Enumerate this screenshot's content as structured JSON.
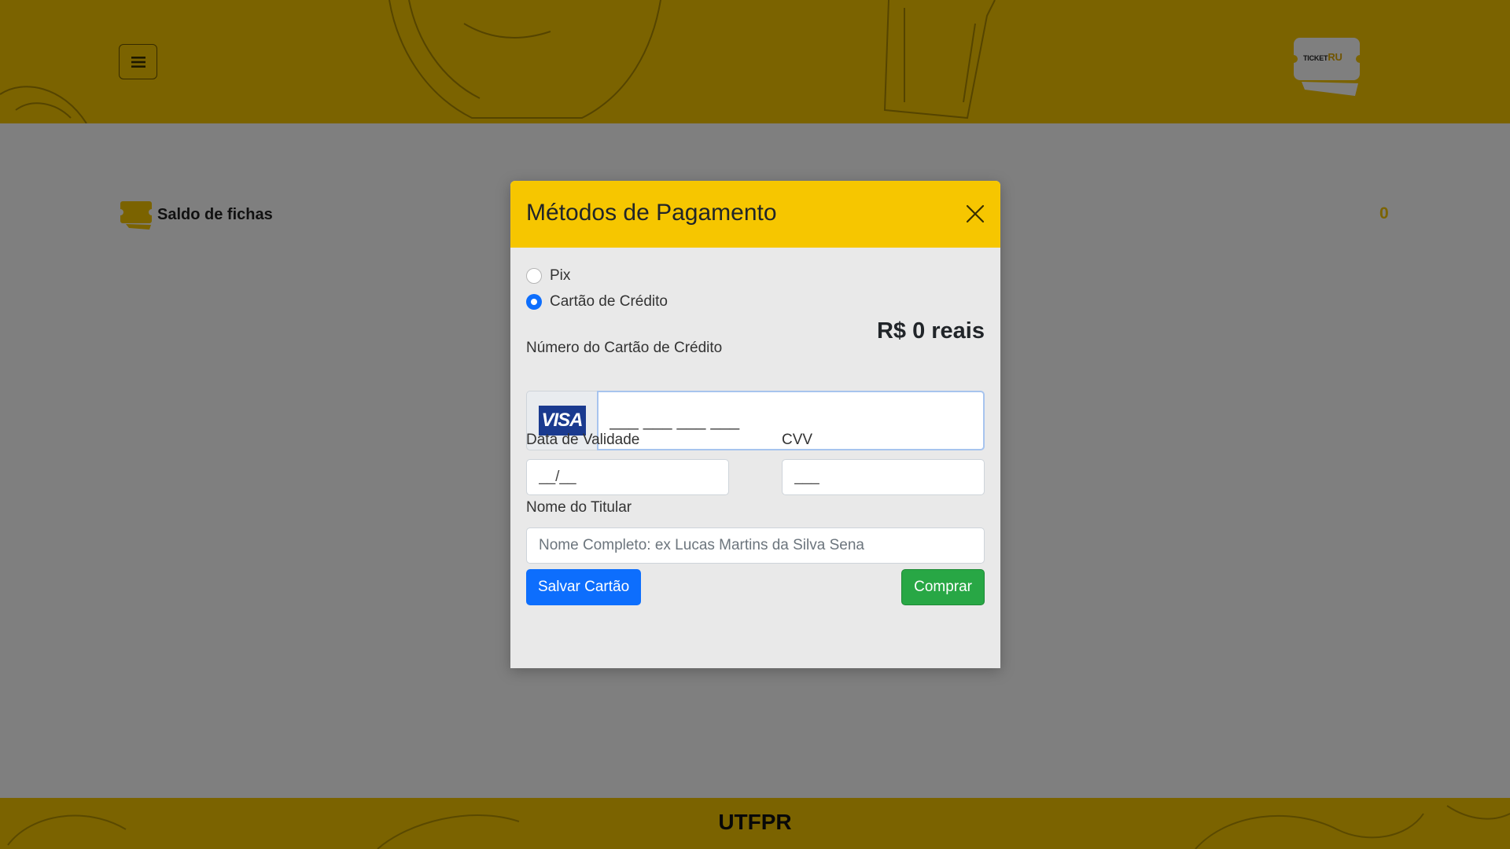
{
  "header": {
    "menu_icon": "hamburger-icon",
    "logo": {
      "text_ticket": "TICKET",
      "text_ru": "RU"
    }
  },
  "balance": {
    "icon": "ticket-icon",
    "label": "Saldo de fichas",
    "count": "0"
  },
  "footer": {
    "label": "UTFPR"
  },
  "modal": {
    "title": "Métodos de Pagamento",
    "close_icon": "close-icon",
    "payment_options": [
      {
        "label": "Pix",
        "checked": false
      },
      {
        "label": "Cartão de Crédito",
        "checked": true
      }
    ],
    "amount": "R$ 0 reais",
    "card_number": {
      "label": "Número do Cartão de Crédito",
      "brand": "VISA",
      "value": "___ ___ ___ ___"
    },
    "expiry": {
      "label": "Data de Validade",
      "value": "__/__"
    },
    "cvv": {
      "label": "CVV",
      "value": "___"
    },
    "holder": {
      "label": "Nome do Titular",
      "placeholder": "Nome Completo: ex Lucas Martins da Silva Sena"
    },
    "save_button": "Salvar Cartão",
    "buy_button": "Comprar"
  },
  "colors": {
    "brand_yellow": "#f6c600",
    "primary": "#0d6efd",
    "success": "#28a745",
    "visa_blue": "#1a3a8f"
  }
}
